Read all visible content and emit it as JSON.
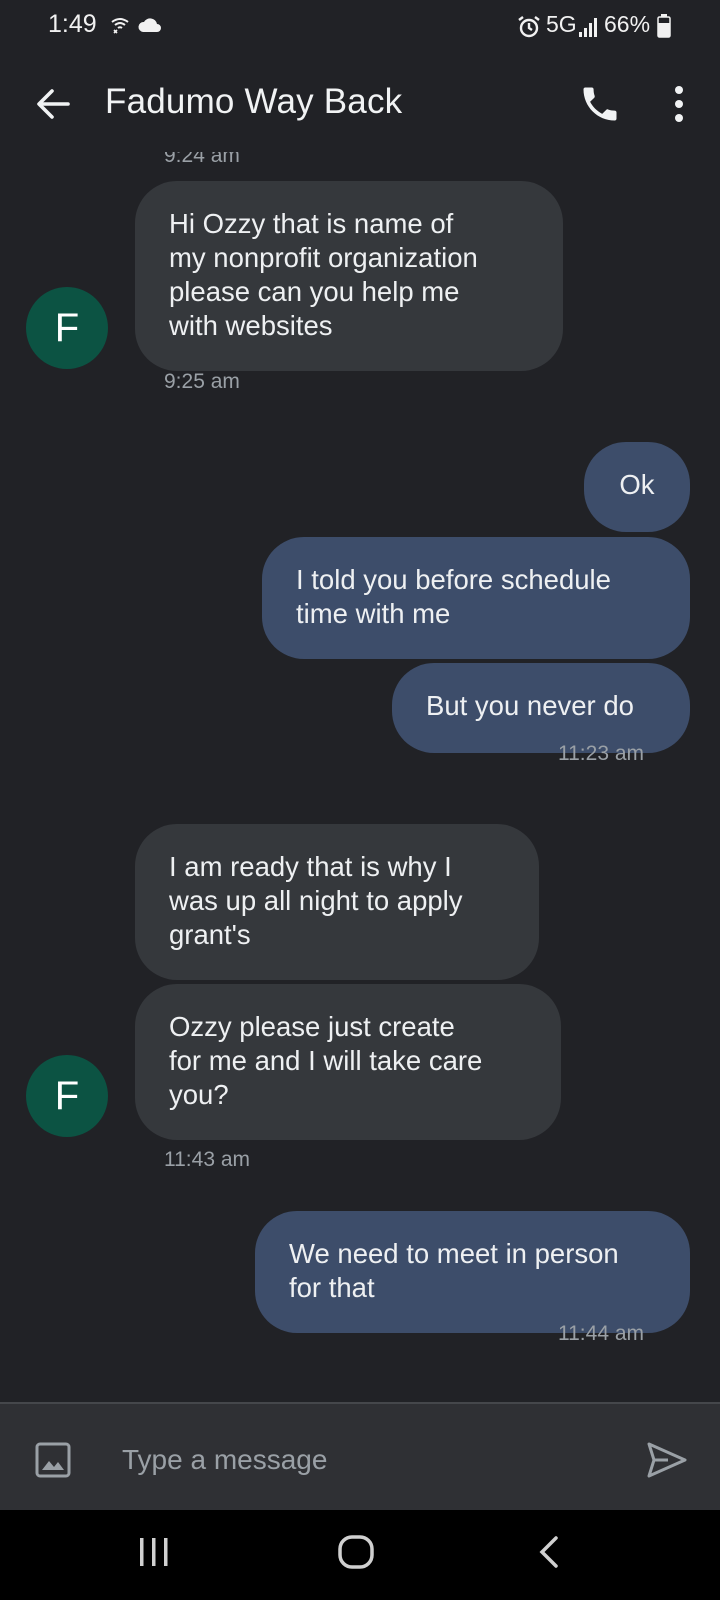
{
  "status_bar": {
    "time": "1:49",
    "network": "5G",
    "battery": "66%",
    "icons": [
      "wifi-calling-icon",
      "cloud-icon",
      "alarm-icon",
      "signal-icon",
      "battery-icon"
    ]
  },
  "app_bar": {
    "title": "Fadumo Way Back",
    "icons": [
      "back-arrow-icon",
      "phone-icon",
      "more-vert-icon"
    ]
  },
  "thread": {
    "prev_timestamp": "9:24 am",
    "messages": [
      {
        "direction": "incoming",
        "text": "Hi Ozzy that is name of\nmy nonprofit organization\nplease can you help me\nwith websites"
      },
      {
        "direction": "outgoing",
        "text": "Ok"
      },
      {
        "direction": "outgoing",
        "text": "I told you before schedule\ntime with me"
      },
      {
        "direction": "outgoing",
        "text": "But you never do"
      },
      {
        "direction": "incoming",
        "text": "I am ready that is why I\nwas up all night to apply\ngrant's"
      },
      {
        "direction": "incoming",
        "text": "Ozzy please just create\nfor me and I will take care\nyou?"
      },
      {
        "direction": "outgoing",
        "text": "We need to meet in person\nfor that"
      }
    ],
    "timestamps": [
      "9:25 am",
      "11:23 am",
      "11:43 am",
      "11:44 am"
    ],
    "avatar_letter": "F",
    "colors": {
      "background": "#212226",
      "incoming_bubble": "#35383c",
      "outgoing_bubble": "#3d4d6a",
      "avatar": "#0c5343"
    }
  },
  "composer": {
    "placeholder": "Type a message",
    "value": "",
    "icons": [
      "image-icon",
      "send-icon"
    ]
  },
  "nav_bar": {
    "icons": [
      "recents-icon",
      "home-icon",
      "back-icon"
    ]
  }
}
